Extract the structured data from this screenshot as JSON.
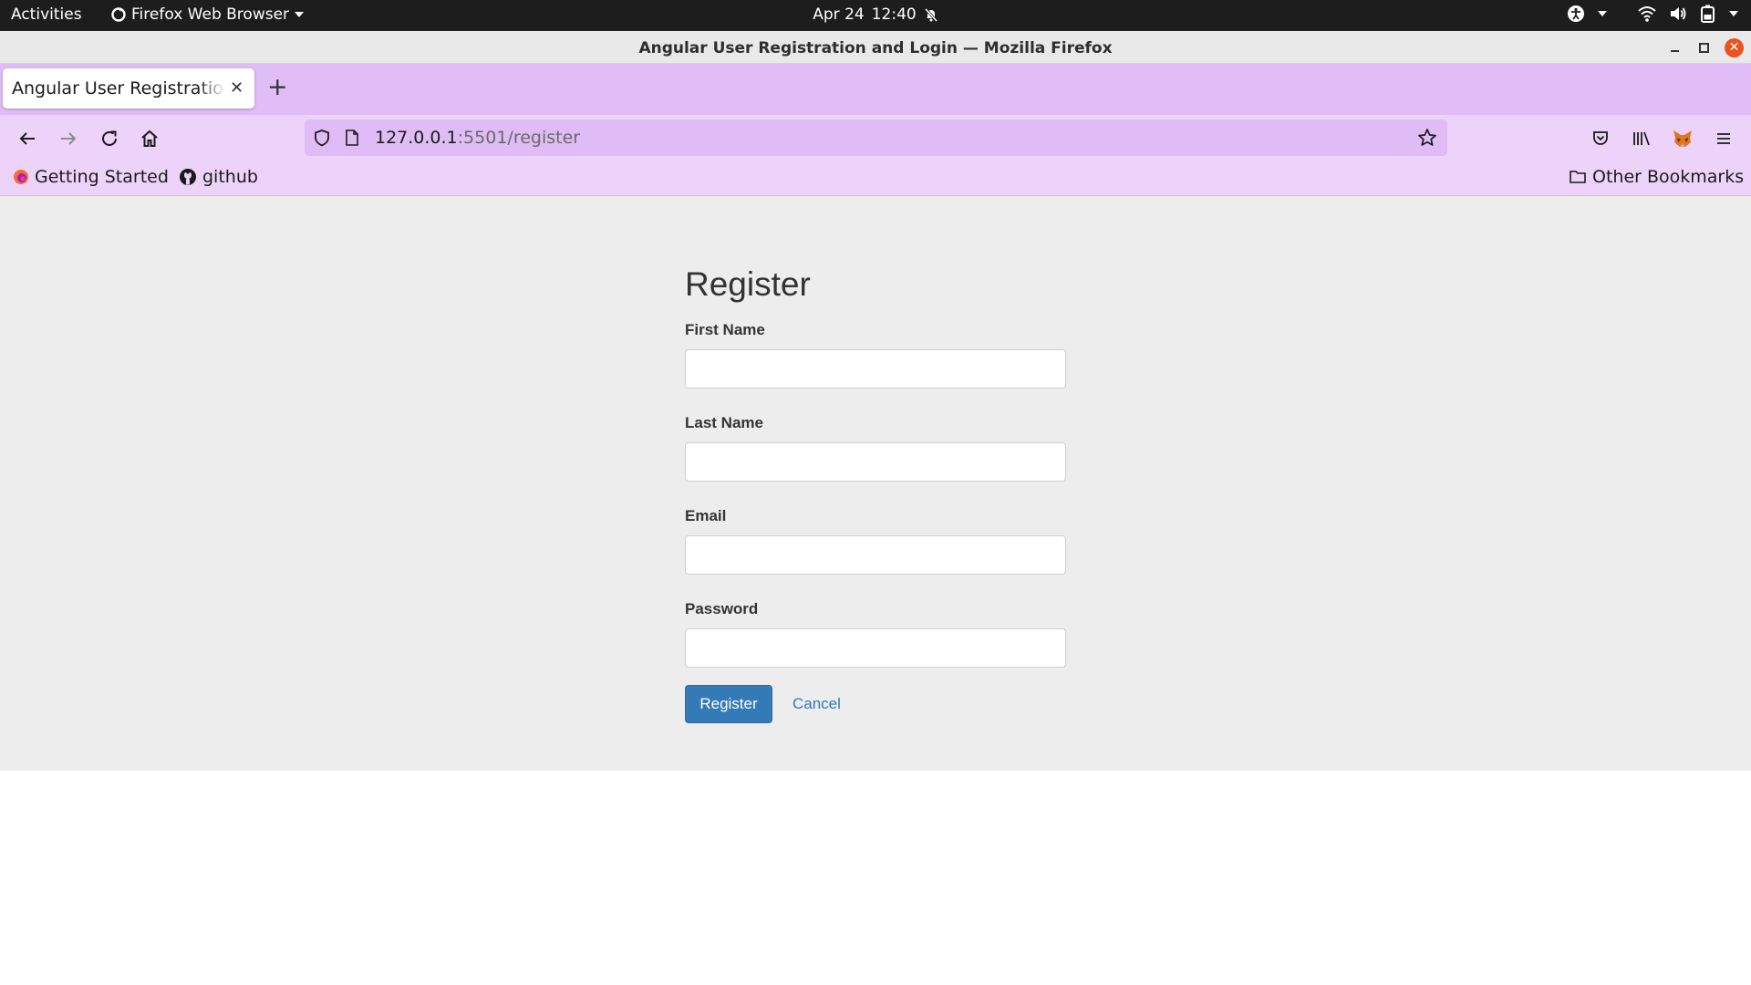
{
  "system_bar": {
    "activities": "Activities",
    "app_menu": "Firefox Web Browser",
    "date": "Apr 24",
    "time": "12:40"
  },
  "window": {
    "title": "Angular User Registration and Login — Mozilla Firefox"
  },
  "tabs": [
    {
      "title": "Angular User Registration and Login"
    }
  ],
  "navbar": {
    "url_host": "127.0.0.1",
    "url_rest": ":5501/register"
  },
  "bookmarks": {
    "items": [
      {
        "label": "Getting Started",
        "icon": "firefox-icon"
      },
      {
        "label": "github",
        "icon": "github-icon"
      }
    ],
    "other": "Other Bookmarks"
  },
  "page": {
    "heading": "Register",
    "fields": [
      {
        "label": "First Name",
        "value": ""
      },
      {
        "label": "Last Name",
        "value": ""
      },
      {
        "label": "Email",
        "value": ""
      },
      {
        "label": "Password",
        "value": ""
      }
    ],
    "submit_label": "Register",
    "cancel_label": "Cancel"
  },
  "colors": {
    "tab_strip": "#e0bdf7",
    "toolbar": "#edd3fa",
    "primary_button": "#337ab7",
    "page_background": "#ededed"
  }
}
